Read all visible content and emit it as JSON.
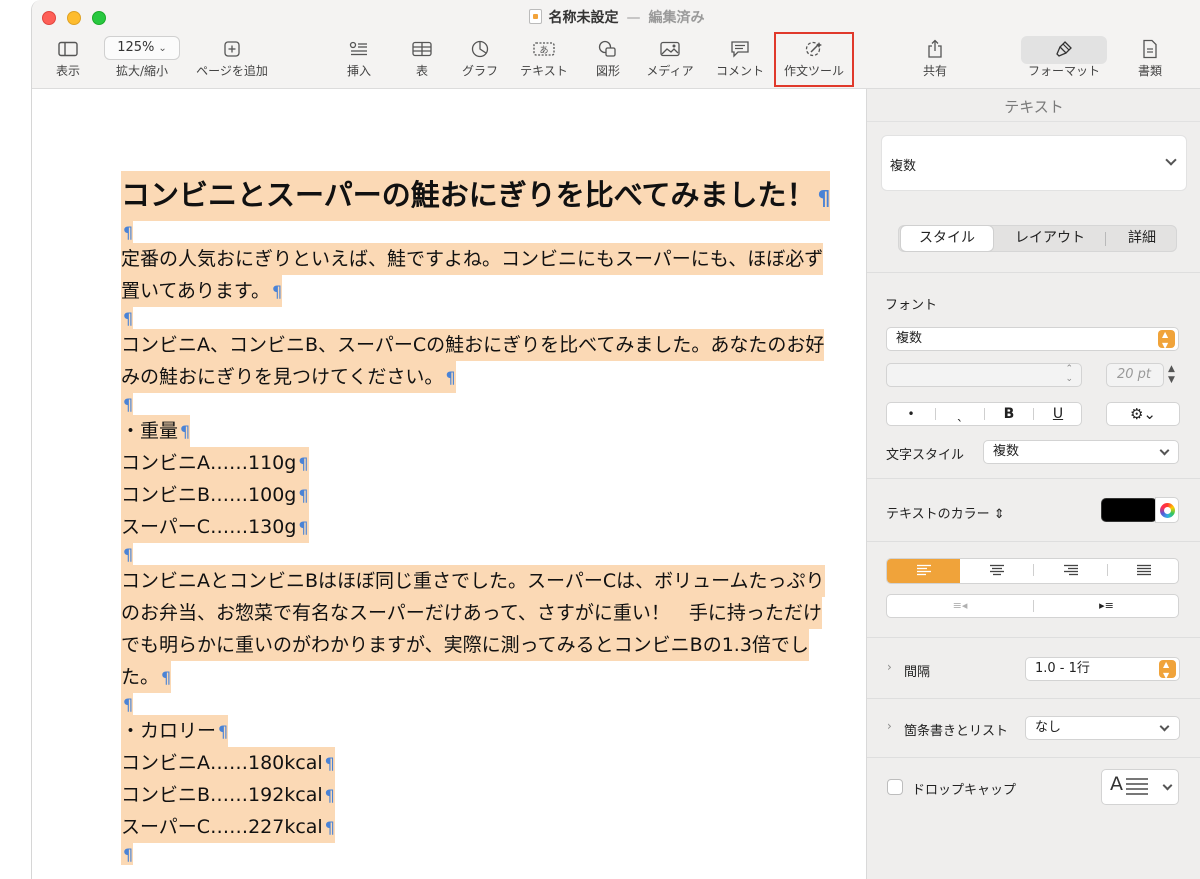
{
  "window": {
    "title": "名称未設定",
    "status": "編集済み"
  },
  "toolbar": {
    "view_label": "表示",
    "zoom_value": "125%",
    "zoom_label": "拡大/縮小",
    "add_page_label": "ページを追加",
    "insert_label": "挿入",
    "table_label": "表",
    "chart_label": "グラフ",
    "text_label": "テキスト",
    "shape_label": "図形",
    "media_label": "メディア",
    "comment_label": "コメント",
    "writing_tools_label": "作文ツール",
    "share_label": "共有",
    "format_label": "フォーマット",
    "document_label": "書類"
  },
  "document": {
    "title": "コンビニとスーパーの鮭おにぎりを比べてみました！",
    "lines": [
      "定番の人気おにぎりといえば、鮭ですよね。コンビニにもスーパーにも、ほぼ必ず",
      "置いてあります。",
      "コンビニA、コンビニB、スーパーCの鮭おにぎりを比べてみました。あなたのお好",
      "みの鮭おにぎりを見つけてください。",
      "・重量",
      "コンビニA……110g",
      "コンビニB……100g",
      "スーパーC……130g",
      "コンビニAとコンビニBはほぼ同じ重さでした。スーパーCは、ボリュームたっぷり",
      "のお弁当、お惣菜で有名なスーパーだけあって、さすがに重い！　手に持っただけ",
      "でも明らかに重いのがわかりますが、実際に測ってみるとコンビニBの1.3倍でし",
      "た。",
      "・カロリー",
      "コンビニA……180kcal",
      "コンビニB……192kcal",
      "スーパーC……227kcal"
    ],
    "pilcrow": "¶"
  },
  "inspector": {
    "header": "テキスト",
    "paragraph_style": "複数",
    "tabs": [
      "スタイル",
      "レイアウト",
      "詳細"
    ],
    "font_section": "フォント",
    "font_family": "複数",
    "font_size": "20 pt",
    "format_buttons": [
      "•",
      "ˎ",
      "B",
      "U"
    ],
    "character_style_label": "文字スタイル",
    "character_style_value": "複数",
    "text_color_label": "テキストのカラー",
    "text_color": "#000000",
    "accent_color": "#f0a33a",
    "spacing_label": "間隔",
    "spacing_value": "1.0 - 1行",
    "bullets_label": "箇条書きとリスト",
    "bullets_value": "なし",
    "dropcap_label": "ドロップキャップ",
    "dropcap_glyph": "A"
  }
}
